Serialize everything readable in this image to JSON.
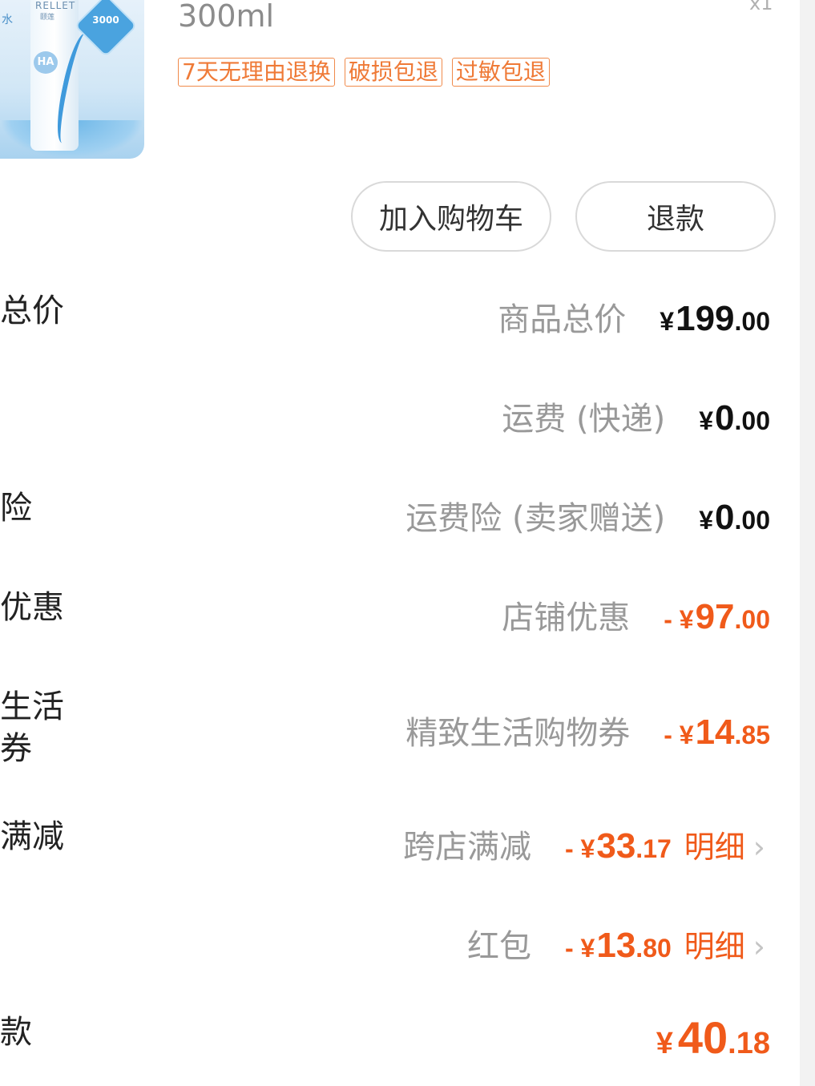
{
  "product": {
    "image": {
      "brand": "RELLET",
      "brand_cn": "颐莲",
      "side_text": "水",
      "ha_label": "HA",
      "badge_text": "3000"
    },
    "spec": "300ml",
    "quantity": "x1",
    "tags": [
      "7天无理由退换",
      "破损包退",
      "过敏包退"
    ]
  },
  "actions": {
    "add_to_cart": "加入购物车",
    "refund": "退款"
  },
  "left_labels": [
    "总价",
    "险",
    "优惠",
    "生活\n券",
    "满减",
    "款"
  ],
  "price_rows": [
    {
      "label": "商品总价",
      "currency": "¥",
      "int": "199",
      "dec": ".00",
      "negative": false
    },
    {
      "label": "运费 (快递)",
      "currency": "¥",
      "int": "0",
      "dec": ".00",
      "negative": false
    },
    {
      "label": "运费险 (卖家赠送)",
      "currency": "¥",
      "int": "0",
      "dec": ".00",
      "negative": false
    },
    {
      "label": "店铺优惠",
      "currency": "- ¥",
      "int": "97",
      "dec": ".00",
      "negative": true
    },
    {
      "label": "精致生活购物券",
      "currency": "- ¥",
      "int": "14",
      "dec": ".85",
      "negative": true
    },
    {
      "label": "跨店满减",
      "currency": "- ¥",
      "int": "33",
      "dec": ".17",
      "negative": true,
      "detail": "明细"
    },
    {
      "label": "红包",
      "currency": "- ¥",
      "int": "13",
      "dec": ".80",
      "negative": true,
      "detail": "明细"
    }
  ],
  "total": {
    "currency": "¥",
    "int": "40",
    "dec": ".18"
  },
  "icons": {
    "chevron": "chevron-right-icon"
  },
  "colors": {
    "accent": "#f05a1a",
    "tag": "#ef7a37",
    "label": "#999999"
  }
}
